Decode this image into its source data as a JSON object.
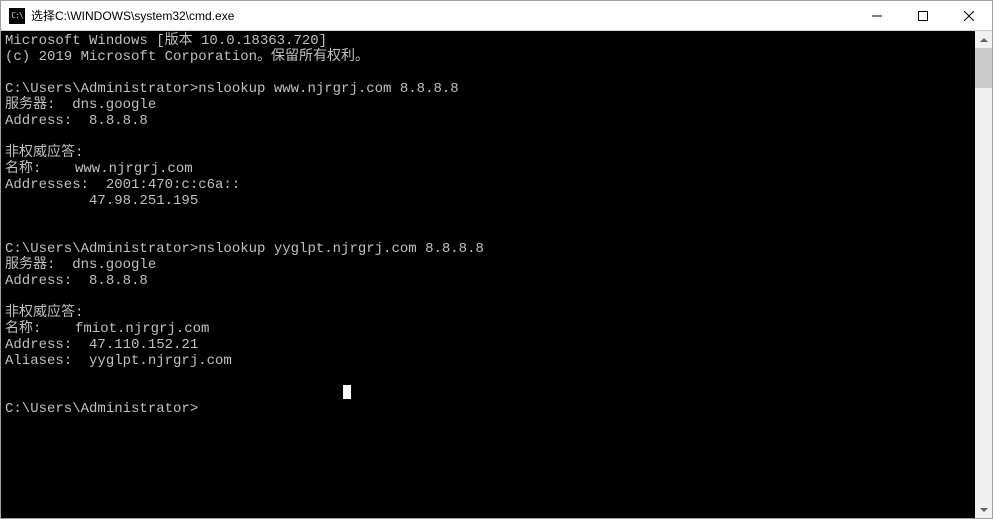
{
  "window": {
    "icon_text": "C:\\",
    "title": "选择C:\\WINDOWS\\system32\\cmd.exe"
  },
  "terminal": {
    "lines": [
      "Microsoft Windows [版本 10.0.18363.720]",
      "(c) 2019 Microsoft Corporation。保留所有权利。",
      "",
      "C:\\Users\\Administrator>nslookup www.njrgrj.com 8.8.8.8",
      "服务器:  dns.google",
      "Address:  8.8.8.8",
      "",
      "非权威应答:",
      "名称:    www.njrgrj.com",
      "Addresses:  2001:470:c:c6a::",
      "          47.98.251.195",
      "",
      "",
      "C:\\Users\\Administrator>nslookup yyglpt.njrgrj.com 8.8.8.8",
      "服务器:  dns.google",
      "Address:  8.8.8.8",
      "",
      "非权威应答:",
      "名称:    fmiot.njrgrj.com",
      "Address:  47.110.152.21",
      "Aliases:  yyglpt.njrgrj.com",
      "",
      "",
      "C:\\Users\\Administrator>"
    ]
  }
}
